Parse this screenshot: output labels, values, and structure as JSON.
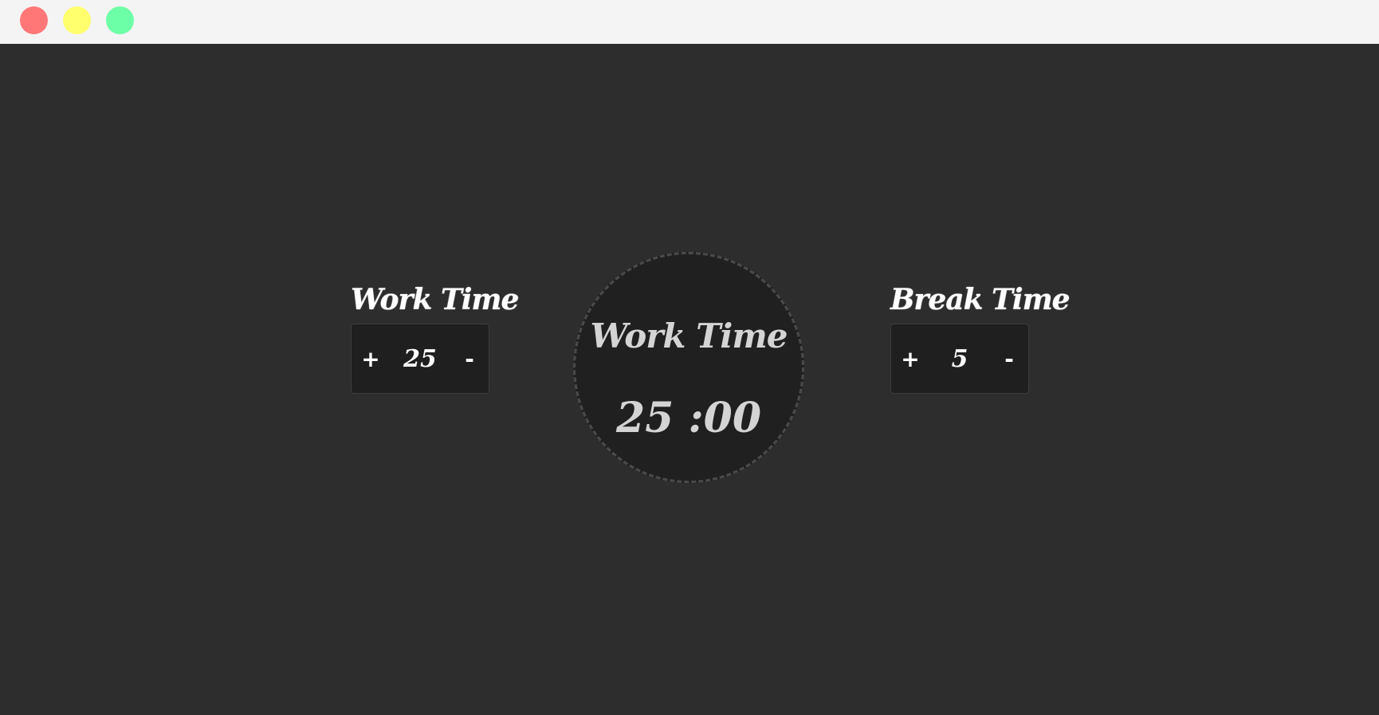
{
  "window": {
    "controls": [
      {
        "name": "close",
        "color": "#ff7777"
      },
      {
        "name": "minimize",
        "color": "#ffff6e"
      },
      {
        "name": "maximize",
        "color": "#6dffa8"
      }
    ]
  },
  "work": {
    "title": "Work Time",
    "increment_label": "+",
    "value": "25",
    "decrement_label": "-"
  },
  "break": {
    "title": "Break Time",
    "increment_label": "+",
    "value": "5",
    "decrement_label": "-"
  },
  "timer": {
    "label": "Work Time",
    "display": "25 :00"
  },
  "colors": {
    "background": "#2d2d2d",
    "titlebar": "#f4f4f4",
    "panel_bg": "#1f1f1f",
    "timer_bg": "#202020",
    "text": "#ffffff",
    "timer_text": "#d4d4d4"
  }
}
